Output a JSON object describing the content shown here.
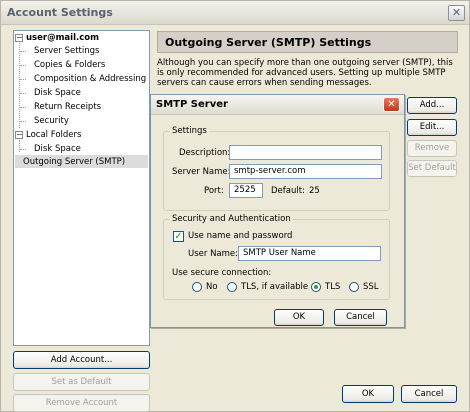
{
  "window": {
    "title": "Account Settings",
    "close_glyph": "✕"
  },
  "tree": {
    "items": [
      {
        "label": "user@mail.com",
        "bold": true
      },
      {
        "label": "Server Settings"
      },
      {
        "label": "Copies & Folders"
      },
      {
        "label": "Composition & Addressing"
      },
      {
        "label": "Disk Space"
      },
      {
        "label": "Return Receipts"
      },
      {
        "label": "Security"
      },
      {
        "label": "Local Folders"
      },
      {
        "label": "Disk Space"
      },
      {
        "label": "Outgoing Server (SMTP)",
        "selected": true
      }
    ],
    "expander_glyph": "−"
  },
  "left_buttons": {
    "add_account": "Add Account...",
    "set_default": "Set as Default",
    "remove_account": "Remove Account"
  },
  "panel": {
    "header": "Outgoing Server (SMTP) Settings",
    "description": "Although you can specify more than one outgoing server (SMTP), this is only recommended for advanced users. Setting up multiple SMTP servers can cause errors when sending messages.",
    "buttons": {
      "add": "Add...",
      "edit": "Edit...",
      "remove": "Remove",
      "set_default": "Set Default"
    }
  },
  "footer": {
    "ok": "OK",
    "cancel": "Cancel"
  },
  "dialog": {
    "title": "SMTP Server",
    "close_glyph": "✕",
    "settings": {
      "legend": "Settings",
      "description_label": "Description:",
      "description_value": "",
      "server_name_label": "Server Name:",
      "server_name_value": "smtp-server.com",
      "port_label": "Port:",
      "port_value": "2525",
      "default_label": "Default:",
      "default_value": "25"
    },
    "security": {
      "legend": "Security and Authentication",
      "use_name_label": "Use name and password",
      "use_name_checked": true,
      "check_glyph": "✓",
      "user_name_label": "User Name:",
      "user_name_value": "SMTP User Name",
      "secure_label": "Use secure connection:",
      "options": [
        {
          "label": "No",
          "selected": false
        },
        {
          "label": "TLS, if available",
          "selected": false
        },
        {
          "label": "TLS",
          "selected": true
        },
        {
          "label": "SSL",
          "selected": false
        }
      ]
    },
    "ok": "OK",
    "cancel": "Cancel"
  }
}
